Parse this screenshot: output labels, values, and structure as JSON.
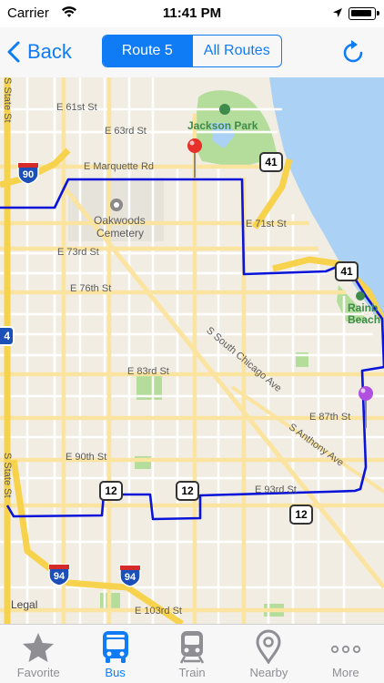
{
  "status_bar": {
    "carrier": "Carrier",
    "time": "11:41 PM"
  },
  "nav": {
    "back_label": "Back",
    "segments": [
      {
        "label": "Route 5",
        "active": true
      },
      {
        "label": "All Routes",
        "active": false
      }
    ]
  },
  "map": {
    "streets": {
      "e61": "E 61st St",
      "e63": "E 63rd St",
      "marquette": "E Marquette Rd",
      "e71": "E 71st St",
      "e73": "E 73rd St",
      "e76": "E 76th St",
      "e83": "E 83rd St",
      "e87": "E 87th St",
      "e90": "E 90th St",
      "e93": "E 93rd St",
      "e103": "E 103rd St",
      "state_top": "S State St",
      "state_bottom": "S State St",
      "south_chicago": "S South Chicago Ave",
      "anthony": "S Anthony Ave"
    },
    "places": {
      "jackson_park": "Jackson Park",
      "oakwoods_line1": "Oakwoods",
      "oakwoods_line2": "Cemetery",
      "rainbow_line1": "Rainb",
      "rainbow_line2": "Beach"
    },
    "shields": {
      "i90": "90",
      "i94_a": "94",
      "i94_b": "94",
      "us41_a": "41",
      "us41_b": "41",
      "us12_a": "12",
      "us12_b": "12",
      "us12_c": "12",
      "left_edge": "4"
    },
    "legal": "Legal",
    "colors": {
      "route": "#0a14d9",
      "water": "#abd1f4",
      "park": "#b4dd9c",
      "highway": "#f7d24c",
      "pin_red": "#e8302a",
      "pin_purple": "#b050e0"
    }
  },
  "tabs": [
    {
      "label": "Favorite",
      "icon": "star-icon",
      "active": false
    },
    {
      "label": "Bus",
      "icon": "bus-icon",
      "active": true
    },
    {
      "label": "Train",
      "icon": "train-icon",
      "active": false
    },
    {
      "label": "Nearby",
      "icon": "location-pin-icon",
      "active": false
    },
    {
      "label": "More",
      "icon": "more-dots-icon",
      "active": false
    }
  ]
}
